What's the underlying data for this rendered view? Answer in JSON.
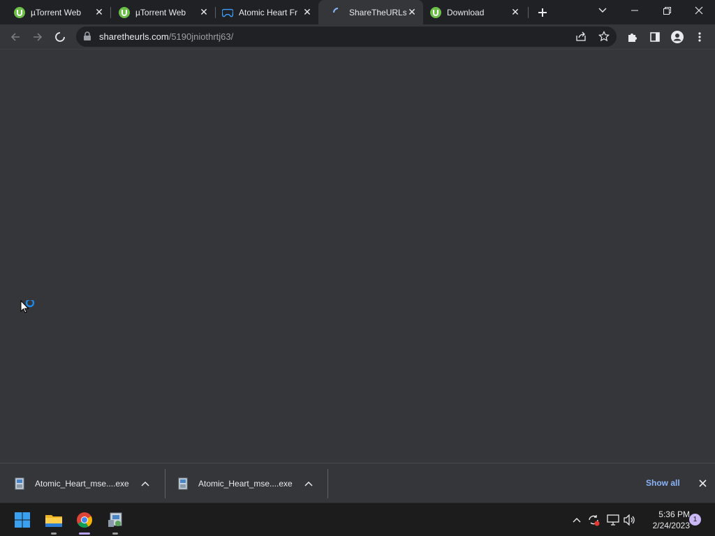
{
  "tabs": [
    {
      "title": "µTorrent Web",
      "icon": "utorrent-icon",
      "active": false
    },
    {
      "title": "µTorrent Web",
      "icon": "utorrent-icon",
      "active": false
    },
    {
      "title": "Atomic Heart Fr",
      "icon": "gamepad-icon",
      "active": false
    },
    {
      "title": "ShareTheURLs -",
      "icon": "loading-spinner-icon",
      "active": true
    },
    {
      "title": "Download",
      "icon": "utorrent-icon",
      "active": false
    }
  ],
  "address_bar": {
    "host": "sharetheurls.com",
    "path": "/5190jniothrtj63/"
  },
  "downloads": [
    {
      "filename": "Atomic_Heart_mse....exe"
    },
    {
      "filename": "Atomic_Heart_mse....exe"
    }
  ],
  "downloads_bar": {
    "show_all_label": "Show all"
  },
  "taskbar": {
    "time": "5:36 PM",
    "date": "2/24/2023",
    "notification_count": "1"
  },
  "colors": {
    "accent": "#8ab4f8",
    "utorrent_green": "#6cc04a",
    "gamepad_blue": "#3aa0ff",
    "page_bg": "#35363a"
  }
}
